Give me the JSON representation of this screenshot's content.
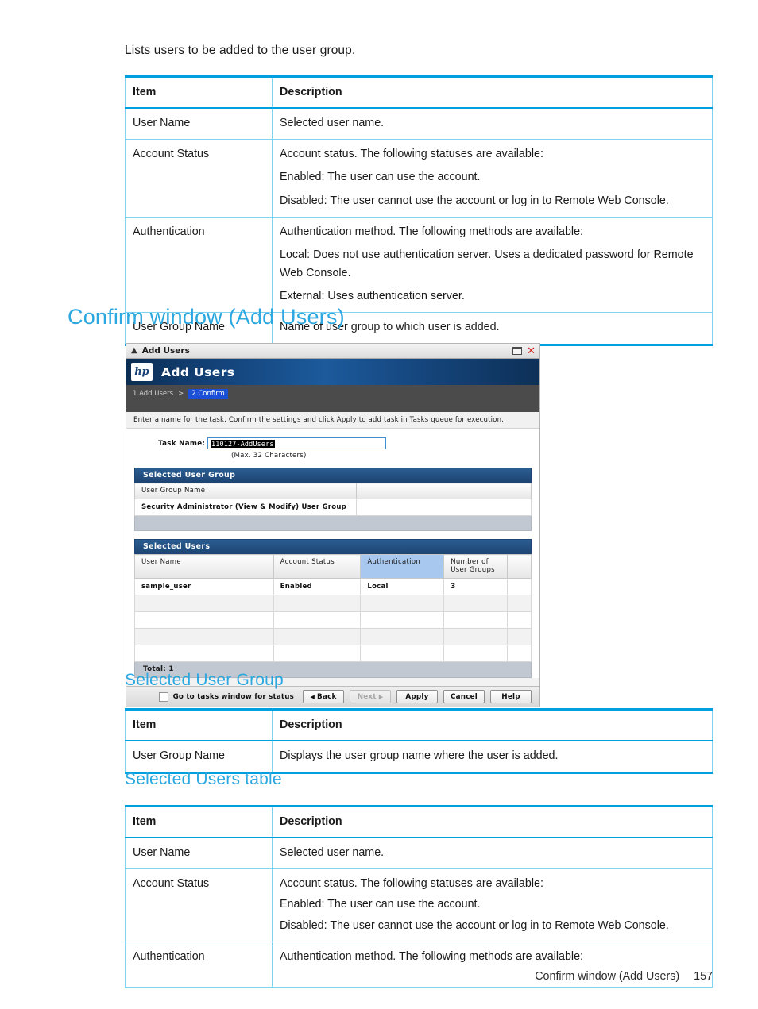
{
  "intro_text": "Lists users to be added to the user group.",
  "table_top": {
    "headers": [
      "Item",
      "Description"
    ],
    "rows": [
      {
        "item": "User Name",
        "desc": [
          "Selected user name."
        ]
      },
      {
        "item": "Account Status",
        "desc": [
          "Account status. The following statuses are available:",
          "Enabled: The user can use the account.",
          "Disabled: The user cannot use the account or log in to Remote Web Console."
        ]
      },
      {
        "item": "Authentication",
        "desc": [
          "Authentication method. The following methods are available:",
          "Local: Does not use authentication server. Uses a dedicated password for Remote Web Console.",
          "External: Uses authentication server."
        ]
      },
      {
        "item": "User Group Name",
        "desc": [
          "Name of user group to which user is added."
        ]
      }
    ]
  },
  "heading_confirm": "Confirm window (Add Users)",
  "dialog": {
    "titlebar": {
      "chevron_icon": "chevron-up-icon",
      "title": "Add Users",
      "restore_icon": "restore-window-icon",
      "close_icon": "close-icon"
    },
    "banner": {
      "logo": "hp",
      "logo_icon": "hp-logo-icon",
      "title": "Add Users"
    },
    "steps": [
      {
        "label": "1.Add Users",
        "active": false
      },
      {
        "label": "2.Confirm",
        "active": true
      }
    ],
    "step_separator": ">",
    "instruction": "Enter a name for the task. Confirm the settings and click Apply to add task in Tasks queue for execution.",
    "task_name_label": "Task Name:",
    "task_name_value": "110127-AddUsers",
    "task_name_hint": "(Max. 32 Characters)",
    "selected_user_group": {
      "panel_title": "Selected User Group",
      "headers": [
        "User Group Name",
        ""
      ],
      "rows": [
        [
          "Security Administrator (View & Modify) User Group",
          ""
        ]
      ]
    },
    "selected_users": {
      "panel_title": "Selected Users",
      "headers": [
        "User Name",
        "Account Status",
        "Authentication",
        "Number of\nUser Groups",
        ""
      ],
      "header_selected_index": 2,
      "rows": [
        [
          "sample_user",
          "Enabled",
          "Local",
          "3",
          ""
        ],
        [
          "",
          "",
          "",
          "",
          ""
        ],
        [
          "",
          "",
          "",
          "",
          ""
        ],
        [
          "",
          "",
          "",
          "",
          ""
        ],
        [
          "",
          "",
          "",
          "",
          ""
        ]
      ],
      "total_label": "Total:  1"
    },
    "buttons": {
      "checkbox_label": "Go to tasks window for status",
      "back": "Back",
      "next": "Next",
      "apply": "Apply",
      "cancel": "Cancel",
      "help": "Help"
    }
  },
  "heading_selected_user_group": "Selected User Group",
  "table_user_group": {
    "headers": [
      "Item",
      "Description"
    ],
    "rows": [
      {
        "item": "User Group Name",
        "desc": [
          "Displays the user group name where the user is added."
        ]
      }
    ]
  },
  "heading_selected_users_table": "Selected Users table",
  "table_bottom": {
    "headers": [
      "Item",
      "Description"
    ],
    "rows": [
      {
        "item": "User Name",
        "desc": [
          "Selected user name."
        ]
      },
      {
        "item": "Account Status",
        "desc": [
          "Account status. The following statuses are available:",
          "Enabled: The user can use the account.",
          "Disabled: The user cannot use the account or log in to Remote Web Console."
        ]
      },
      {
        "item": "Authentication",
        "desc": [
          "Authentication method. The following methods are available:"
        ]
      }
    ]
  },
  "footer": {
    "title": "Confirm window (Add Users)",
    "page": "157"
  },
  "colors": {
    "accent": "#00a0df",
    "heading": "#2ca8e0",
    "table_border": "#7fd2f2",
    "app_header": "#1d4472",
    "selected_col": "#a8c8f0"
  }
}
